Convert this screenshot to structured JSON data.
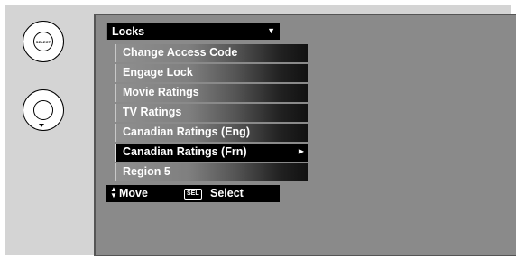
{
  "remote": {
    "select_button_text": "SELECT"
  },
  "menu": {
    "title": "Locks",
    "items": [
      {
        "label": "Change Access Code"
      },
      {
        "label": "Engage Lock"
      },
      {
        "label": "Movie Ratings"
      },
      {
        "label": "TV Ratings"
      },
      {
        "label": "Canadian Ratings (Eng)"
      },
      {
        "label": "Canadian Ratings (Frn)",
        "selected": true
      },
      {
        "label": "Region 5"
      }
    ]
  },
  "hints": {
    "move_label": "Move",
    "sel_key": "SEL",
    "select_label": "Select"
  },
  "icons": {
    "title_dropdown": "triangle-down-icon",
    "submenu": "triangle-right-icon",
    "move": "up-down-arrows-icon"
  }
}
